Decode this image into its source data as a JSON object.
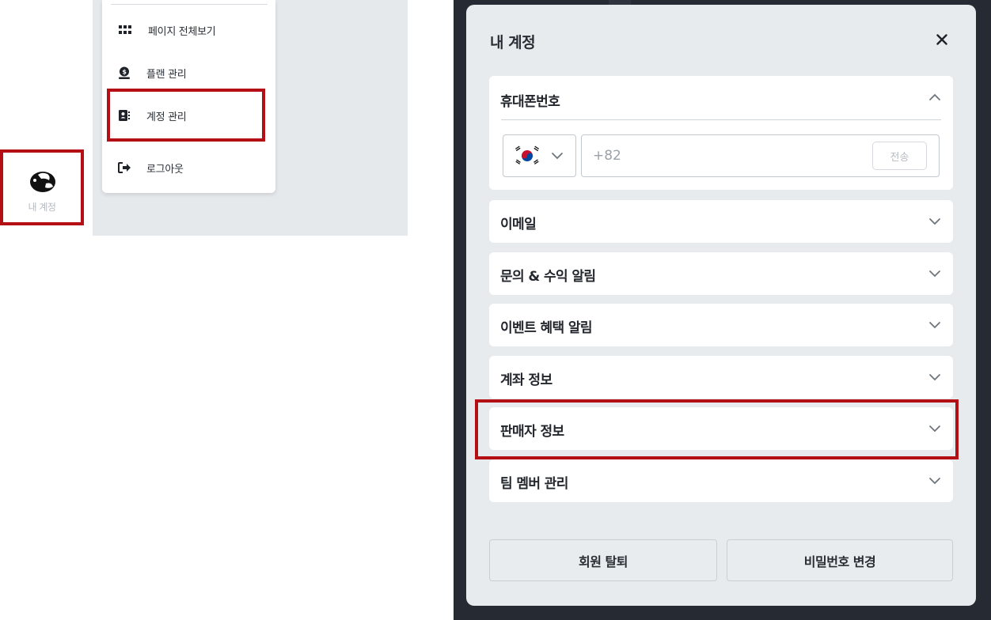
{
  "menu": {
    "items": [
      {
        "label": "페이지 전체보기",
        "icon": "grid-icon"
      },
      {
        "label": "플랜 관리",
        "icon": "plan-icon"
      },
      {
        "label": "계정 관리",
        "icon": "account-book-icon"
      },
      {
        "label": "로그아웃",
        "icon": "logout-icon"
      }
    ]
  },
  "profile": {
    "label": "내 계정",
    "icon": "avatar-icon"
  },
  "modal": {
    "title": "내 계정",
    "close_icon": "close-icon",
    "phone": {
      "title": "휴대폰번호",
      "country_flag": "korea-flag-icon",
      "placeholder": "+82",
      "send_label": "전송"
    },
    "sections": [
      {
        "title": "이메일"
      },
      {
        "title": "문의 & 수익 알림"
      },
      {
        "title": "이벤트 혜택 알림"
      },
      {
        "title": "계좌 정보"
      },
      {
        "title": "판매자 정보"
      },
      {
        "title": "팀 멤버 관리"
      }
    ],
    "buttons": {
      "withdraw": "회원 탈퇴",
      "change_password": "비밀번호 변경"
    }
  },
  "colors": {
    "highlight": "#b30f15",
    "modal_bg": "#e7ebee",
    "backdrop": "#262a33",
    "panel_bg": "#e6e9ec"
  }
}
